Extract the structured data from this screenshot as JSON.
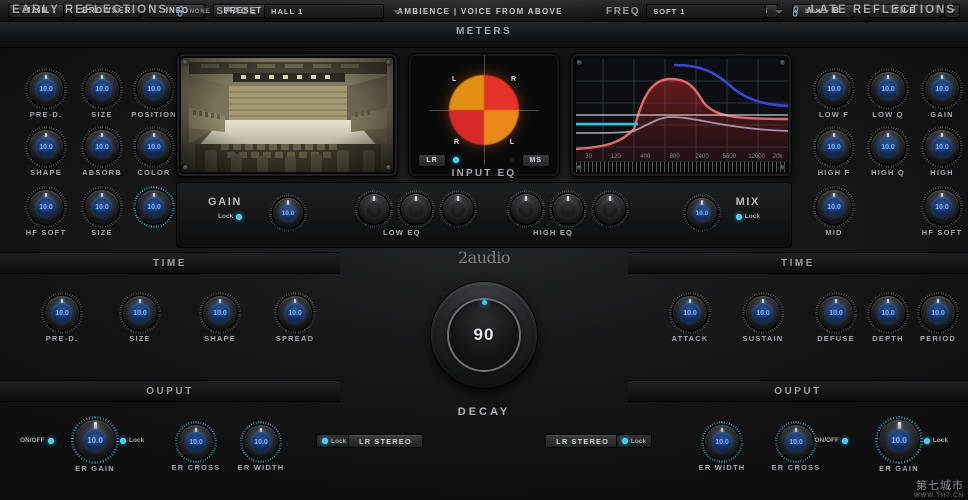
{
  "topbar": {
    "buttons": [
      "MAIN",
      "BROWSER",
      "INFO",
      "PRESET"
    ],
    "preset_title": "AMBIENCE | VOICE FROM ABOVE",
    "ab": [
      "A",
      "B"
    ],
    "ab_copy": "A ◂ ▸ B",
    "file": "FILE"
  },
  "headers": {
    "early_reflections": "EARLY REFLECTIONS",
    "late_reflections": "LATE REFLECTIONS",
    "meters": "METERS",
    "space_label": "SPACE",
    "space_value": "HALL 1",
    "freq_label": "FREQ",
    "freq_value": "SOFT 1",
    "none_tag": "NONE"
  },
  "early": {
    "knobs": [
      {
        "label": "PRE-D.",
        "value": "10.0"
      },
      {
        "label": "SIZE",
        "value": "10.0"
      },
      {
        "label": "POSITION",
        "value": "10.0"
      },
      {
        "label": "SHAPE",
        "value": "10.0"
      },
      {
        "label": "ABSORB",
        "value": "10.0"
      },
      {
        "label": "COLOR",
        "value": "10.0"
      },
      {
        "label": "HF SOFT",
        "value": "10.0"
      },
      {
        "label": "SIZE",
        "value": "10.0"
      },
      {
        "label": "",
        "value": "10.0"
      }
    ]
  },
  "late": {
    "knobs": [
      {
        "label": "LOW F",
        "value": "10.0"
      },
      {
        "label": "LOW Q",
        "value": "10.0"
      },
      {
        "label": "GAIN",
        "value": "10.0"
      },
      {
        "label": "HIGH F",
        "value": "10.0"
      },
      {
        "label": "HIGH Q",
        "value": "10.0"
      },
      {
        "label": "HIGH",
        "value": "10.0"
      },
      {
        "label": "MID",
        "value": "10.0"
      },
      {
        "label": "HF SOFT",
        "value": "10.0"
      }
    ]
  },
  "meters": {
    "quadrants": [
      "L",
      "R",
      "R",
      "L"
    ],
    "lr_button": "LR",
    "ms_button": "MS"
  },
  "eq_graph": {
    "freq_ticks": [
      "30",
      "120",
      "400",
      "800",
      "2400",
      "5600",
      "12000",
      "20k"
    ]
  },
  "input_eq": {
    "title": "INPUT EQ",
    "gain_label": "GAIN",
    "gain_value": "10.0",
    "gain_lock": "Lock",
    "low_eq": "LOW EQ",
    "high_eq": "HIGH EQ",
    "mix_label": "MIX",
    "mix_value": "10.0",
    "mix_lock": "Lock"
  },
  "time_left": {
    "title": "TIME",
    "knobs": [
      {
        "label": "PRE-D.",
        "value": "10.0"
      },
      {
        "label": "SIZE",
        "value": "10.0"
      },
      {
        "label": "SHAPE",
        "value": "10.0"
      },
      {
        "label": "SPREAD",
        "value": "10.0"
      }
    ]
  },
  "time_right": {
    "title": "TIME",
    "knobs": [
      {
        "label": "ATTACK",
        "value": "10.0"
      },
      {
        "label": "SUSTAIN",
        "value": "10.0"
      },
      {
        "label": "DEFUSE",
        "value": "10.0"
      },
      {
        "label": "DEPTH",
        "value": "10.0"
      },
      {
        "label": "PERIOD",
        "value": "10.0"
      }
    ]
  },
  "decay": {
    "logo": "2audio",
    "value": "90",
    "label": "DECAY"
  },
  "output_left": {
    "title": "OUPUT",
    "onoff": "ON/OFF",
    "lock": "Lock",
    "stereo_button": "LR STEREO",
    "stereo_lock": "Lock",
    "knobs": [
      {
        "label": "ER GAIN",
        "value": "10.0"
      },
      {
        "label": "ER CROSS",
        "value": "10.0"
      },
      {
        "label": "ER WIDTH",
        "value": "10.0"
      }
    ]
  },
  "output_right": {
    "title": "OUPUT",
    "onoff": "ON/OFF",
    "lock": "Lock",
    "stereo_button": "LR STEREO",
    "stereo_lock": "Lock",
    "knobs": [
      {
        "label": "ER WIDTH",
        "value": "10.0"
      },
      {
        "label": "ER CROSS",
        "value": "10.0"
      },
      {
        "label": "ER GAIN",
        "value": "10.0"
      }
    ]
  },
  "watermark": {
    "line1": "第七城市",
    "line2": "WWW.TH7.CN"
  },
  "colors": {
    "accent_blue": "#2fc6ef",
    "knob_value_blue": "#7fb2ff",
    "meter_red": "#d8352c",
    "meter_orange": "#e08a22",
    "eq_curve_red": "#e06a72",
    "eq_curve_blue": "#3a46d8",
    "eq_curve_cyan": "#25c2e8"
  }
}
